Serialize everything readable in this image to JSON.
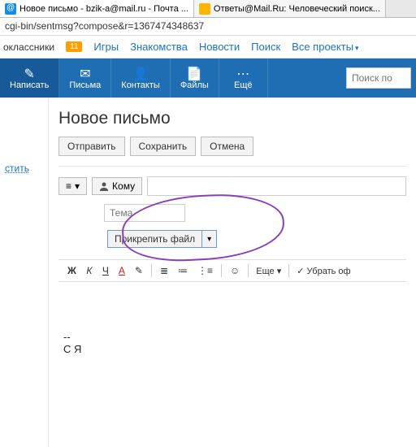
{
  "tabs": [
    {
      "title": "Новое письмо - bzik-a@mail.ru - Почта ...",
      "icon": "mail"
    },
    {
      "title": "Ответы@Mail.Ru: Человеческий поиск...",
      "icon": "answers"
    }
  ],
  "url": "cgi-bin/sentmsg?compose&r=1367474348637",
  "topnav": {
    "ok": "оклассники",
    "badge": "11",
    "links": [
      "Игры",
      "Знакомства",
      "Новости",
      "Поиск",
      "Все проекты"
    ]
  },
  "bluebar": {
    "items": [
      {
        "label": "Написать",
        "icon": "✎"
      },
      {
        "label": "Письма",
        "icon": "✉"
      },
      {
        "label": "Контакты",
        "icon": "👤"
      },
      {
        "label": "Файлы",
        "icon": "📄"
      },
      {
        "label": "Ещё",
        "icon": "⋯"
      }
    ],
    "search_placeholder": "Поиск по"
  },
  "left": {
    "clear": "стить"
  },
  "compose": {
    "title": "Новое письмо",
    "send": "Отправить",
    "save": "Сохранить",
    "cancel": "Отмена",
    "priority": "≡",
    "to": "Кому",
    "subject_placeholder": "Тема",
    "attach": "Прикрепить файл",
    "attach_drop": "▾"
  },
  "toolbar": {
    "bold": "Ж",
    "italic": "К",
    "underline": "Ч",
    "color": "А",
    "highlight": "✎",
    "align": "≣",
    "list_o": "≔",
    "list_u": "⋮≡",
    "emoji": "☺",
    "more": "Еще",
    "remove": "Убрать оф"
  },
  "body": {
    "sig1": "--",
    "sig2": "С Я"
  }
}
